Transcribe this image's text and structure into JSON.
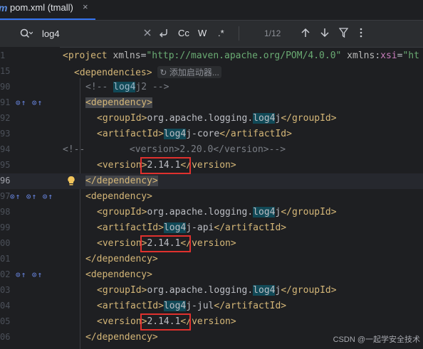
{
  "tab": {
    "label": "pom.xml (tmall)",
    "close": "×",
    "file_icon": "m"
  },
  "find": {
    "query": "log4",
    "match_count": "1/12",
    "case_label": "Cc",
    "word_label": "W",
    "regex_label": ".*"
  },
  "gutter": {
    "lines": [
      "1",
      "15",
      "90",
      "91",
      "92",
      "93",
      "94",
      "95",
      "96",
      "97",
      "98",
      "99",
      "00",
      "01",
      "02",
      "03",
      "04",
      "05",
      "06"
    ],
    "current_index": 8
  },
  "code": {
    "line1": {
      "p1": "<project ",
      "p2": "xmlns",
      "p3": "=",
      "p4": "\"http://maven.apache.org/POM/4.0.0\"",
      "p5": " xmlns",
      "p6": ":",
      "p7": "xsi",
      "p8": "=",
      "p9": "\"ht"
    },
    "line2": {
      "p1": "<dependencies>",
      "hint": "添加启动器..."
    },
    "line3": {
      "p1": "<!-- ",
      "p2": "log4",
      "p3": "j2 -->"
    },
    "line4": {
      "p1": "<dependency>"
    },
    "line5": {
      "p1": "<groupId>",
      "p2": "org.apache.logging.",
      "p3": "log4",
      "p4": "j",
      "p5": "</groupId>"
    },
    "line6": {
      "p1": "<artifactId>",
      "p2": "log4",
      "p3": "j-core",
      "p4": "</artifactId>"
    },
    "line7": {
      "p1": "<!--",
      "p2": "        <version>2.20.0</version>-->"
    },
    "line8": {
      "p1": "<version>",
      "p2": "2.14.1",
      "p3": "</version>"
    },
    "line9": {
      "p1": "</dependency>"
    },
    "line10": {
      "p1": "<dependency>"
    },
    "line11": {
      "p1": "<groupId>",
      "p2": "org.apache.logging.",
      "p3": "log4",
      "p4": "j",
      "p5": "</groupId>"
    },
    "line12": {
      "p1": "<artifactId>",
      "p2": "log4",
      "p3": "j-api",
      "p4": "</artifactId>"
    },
    "line13": {
      "p1": "<version>",
      "p2": "2.14.1",
      "p3": "</version>"
    },
    "line14": {
      "p1": "</dependency>"
    },
    "line15": {
      "p1": "<dependency>"
    },
    "line16": {
      "p1": "<groupId>",
      "p2": "org.apache.logging.",
      "p3": "log4",
      "p4": "j",
      "p5": "</groupId>"
    },
    "line17": {
      "p1": "<artifactId>",
      "p2": "log4",
      "p3": "j-jul",
      "p4": "</artifactId>"
    },
    "line18": {
      "p1": "<version>",
      "p2": "2.14.1",
      "p3": "</version>"
    },
    "line19": {
      "p1": "</dependency>"
    }
  },
  "gutter_icons": {
    "l91": "⊙↑ ⊙↑",
    "l97": "⊙↑ ⊙↑ ⊙↑",
    "l02": "⊙↑ ⊙↑"
  },
  "watermark": "CSDN @一起学安全技术",
  "colors": {
    "accent": "#3574f0",
    "highlight_box": "#e0312e",
    "tag": "#d5b778",
    "string": "#6aab73"
  }
}
